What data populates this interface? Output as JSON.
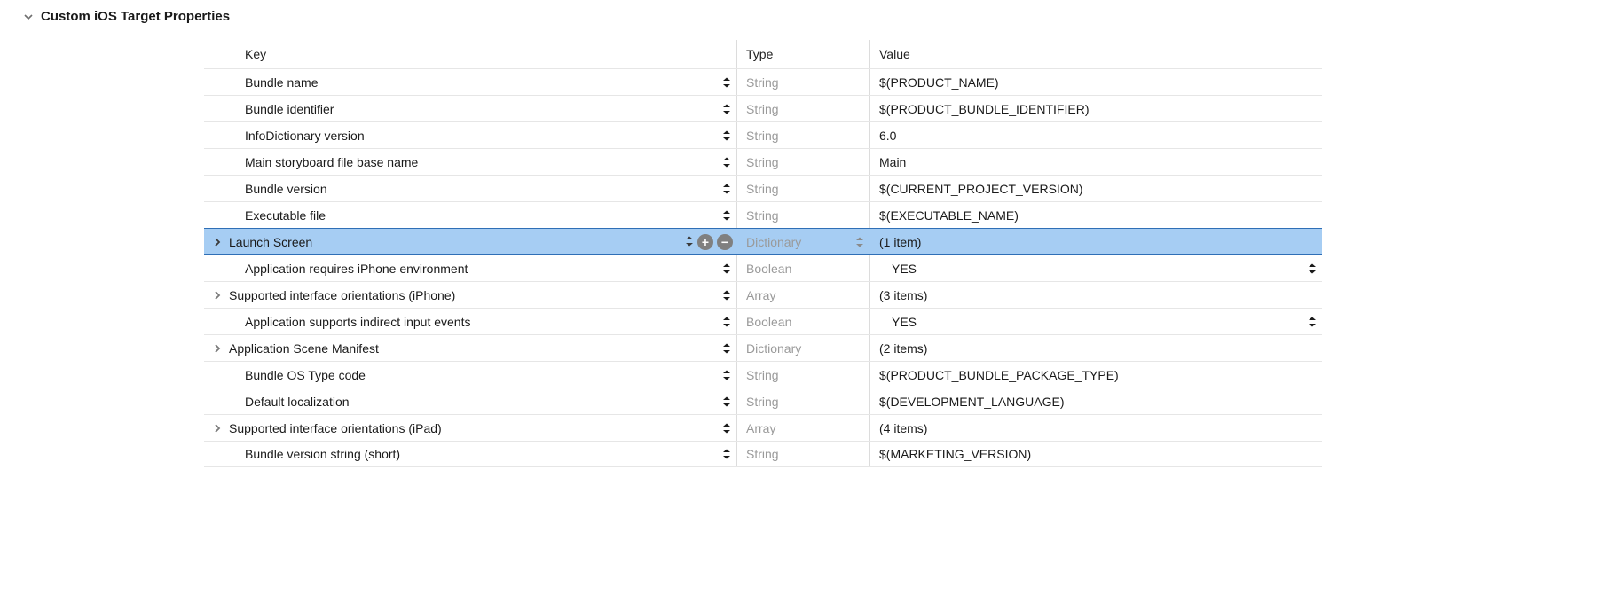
{
  "section_title": "Custom iOS Target Properties",
  "headers": {
    "key": "Key",
    "type": "Type",
    "value": "Value"
  },
  "rows": [
    {
      "key": "Bundle name",
      "type": "String",
      "value": "$(PRODUCT_NAME)"
    },
    {
      "key": "Bundle identifier",
      "type": "String",
      "value": "$(PRODUCT_BUNDLE_IDENTIFIER)"
    },
    {
      "key": "InfoDictionary version",
      "type": "String",
      "value": "6.0"
    },
    {
      "key": "Main storyboard file base name",
      "type": "String",
      "value": "Main"
    },
    {
      "key": "Bundle version",
      "type": "String",
      "value": "$(CURRENT_PROJECT_VERSION)"
    },
    {
      "key": "Executable file",
      "type": "String",
      "value": "$(EXECUTABLE_NAME)"
    },
    {
      "key": "Launch Screen",
      "type": "Dictionary",
      "value": "(1 item)"
    },
    {
      "key": "Application requires iPhone environment",
      "type": "Boolean",
      "value": "YES"
    },
    {
      "key": "Supported interface orientations (iPhone)",
      "type": "Array",
      "value": "(3 items)"
    },
    {
      "key": "Application supports indirect input events",
      "type": "Boolean",
      "value": "YES"
    },
    {
      "key": "Application Scene Manifest",
      "type": "Dictionary",
      "value": "(2 items)"
    },
    {
      "key": "Bundle OS Type code",
      "type": "String",
      "value": "$(PRODUCT_BUNDLE_PACKAGE_TYPE)"
    },
    {
      "key": "Default localization",
      "type": "String",
      "value": "$(DEVELOPMENT_LANGUAGE)"
    },
    {
      "key": "Supported interface orientations (iPad)",
      "type": "Array",
      "value": "(4 items)"
    },
    {
      "key": "Bundle version string (short)",
      "type": "String",
      "value": "$(MARKETING_VERSION)"
    }
  ],
  "row_meta": [
    {
      "disclosure": "",
      "selected": false,
      "value_stepper": false
    },
    {
      "disclosure": "",
      "selected": false,
      "value_stepper": false
    },
    {
      "disclosure": "",
      "selected": false,
      "value_stepper": false
    },
    {
      "disclosure": "",
      "selected": false,
      "value_stepper": false
    },
    {
      "disclosure": "",
      "selected": false,
      "value_stepper": false
    },
    {
      "disclosure": "",
      "selected": false,
      "value_stepper": false
    },
    {
      "disclosure": "right",
      "selected": true,
      "value_stepper": false
    },
    {
      "disclosure": "",
      "selected": false,
      "value_stepper": true
    },
    {
      "disclosure": "right",
      "selected": false,
      "value_stepper": false
    },
    {
      "disclosure": "",
      "selected": false,
      "value_stepper": true
    },
    {
      "disclosure": "right",
      "selected": false,
      "value_stepper": false
    },
    {
      "disclosure": "",
      "selected": false,
      "value_stepper": false
    },
    {
      "disclosure": "",
      "selected": false,
      "value_stepper": false
    },
    {
      "disclosure": "right",
      "selected": false,
      "value_stepper": false
    },
    {
      "disclosure": "",
      "selected": false,
      "value_stepper": false
    }
  ]
}
